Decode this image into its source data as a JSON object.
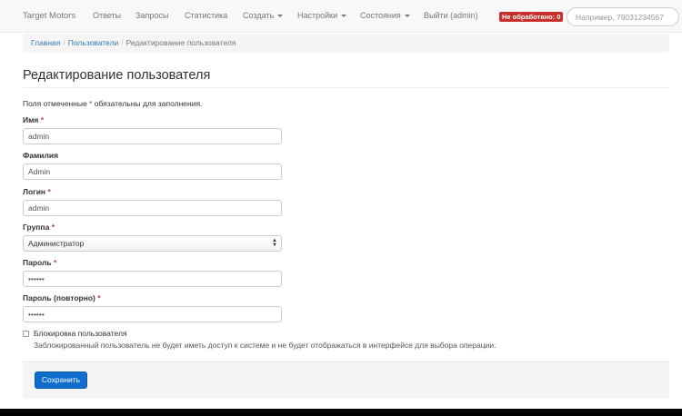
{
  "navbar": {
    "brand": "Target Motors",
    "items": [
      {
        "label": "Ответы",
        "dropdown": false
      },
      {
        "label": "Запросы",
        "dropdown": false
      },
      {
        "label": "Статистика",
        "dropdown": false
      },
      {
        "label": "Создать",
        "dropdown": true
      },
      {
        "label": "Настройки",
        "dropdown": true
      },
      {
        "label": "Состояния",
        "dropdown": true
      },
      {
        "label": "Выйти (admin)",
        "dropdown": false
      }
    ],
    "badge": "Не обработано: 0",
    "badge_color": "#c9302c",
    "search_placeholder": "Например, 79031234567"
  },
  "breadcrumb": {
    "home": "Главная",
    "users": "Пользователи",
    "current": "Редактирование пользователя",
    "separator": "/"
  },
  "page": {
    "title": "Редактирование пользователя",
    "required_note_before": "Поля отмеченные ",
    "required_mark": "*",
    "required_note_after": " обязательны для заполнения."
  },
  "form": {
    "first_name": {
      "label": "Имя",
      "value": "admin"
    },
    "last_name": {
      "label": "Фамилия",
      "value": "Admin"
    },
    "login": {
      "label": "Логин",
      "value": "admin"
    },
    "group": {
      "label": "Группа",
      "value": "Администратор"
    },
    "password": {
      "label": "Пароль",
      "value": "••••••"
    },
    "password_repeat": {
      "label": "Пароль (повторно)",
      "value": "••••••"
    },
    "block_user": {
      "label": "Блокировка пользователя",
      "checked": false,
      "help": "Заблокированный пользователь не будет иметь доступ к системе и не будет отображаться в интерфейсе для выбора операции."
    },
    "save_label": "Сохранить"
  },
  "colors": {
    "primary": "#0f6ecd",
    "link": "#337ab7",
    "required": "#a94442"
  }
}
